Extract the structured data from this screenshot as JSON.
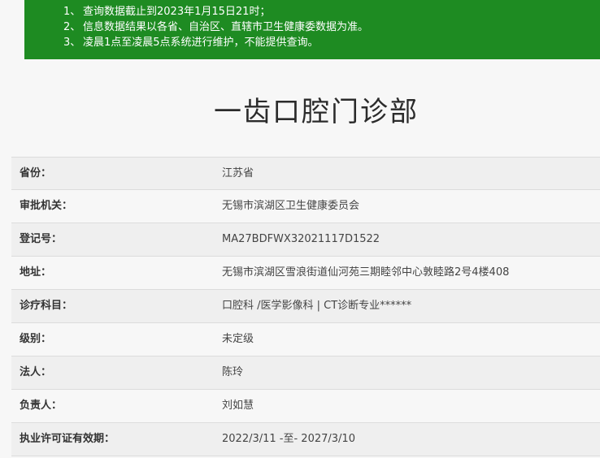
{
  "notice": {
    "items": [
      {
        "num": "1、",
        "text": "查询数据截止到2023年1月15日21时；"
      },
      {
        "num": "2、",
        "text": "信息数据结果以各省、自治区、直辖市卫生健康委数据为准。"
      },
      {
        "num": "3、",
        "text": "凌晨1点至凌晨5点系统进行维护，不能提供查询。"
      }
    ]
  },
  "title": "一齿口腔门诊部",
  "details": [
    {
      "label": "省份：",
      "value": "江苏省"
    },
    {
      "label": "审批机关：",
      "value": "无锡市滨湖区卫生健康委员会"
    },
    {
      "label": "登记号：",
      "value": "MA27BDFWX32021117D1522"
    },
    {
      "label": "地址：",
      "value": "无锡市滨湖区雪浪街道仙河苑三期睦邻中心敦睦路2号4楼408"
    },
    {
      "label": "诊疗科目：",
      "value": "口腔科 /医学影像科  |  CT诊断专业******"
    },
    {
      "label": "级别：",
      "value": "未定级"
    },
    {
      "label": "法人：",
      "value": "陈玲"
    },
    {
      "label": "负责人：",
      "value": "刘如慧"
    },
    {
      "label": "执业许可证有效期：",
      "value": "2022/3/11 -至- 2027/3/10"
    }
  ],
  "colors": {
    "notice_bg": "#1e8b22",
    "title_text": "#2b2b2b"
  }
}
